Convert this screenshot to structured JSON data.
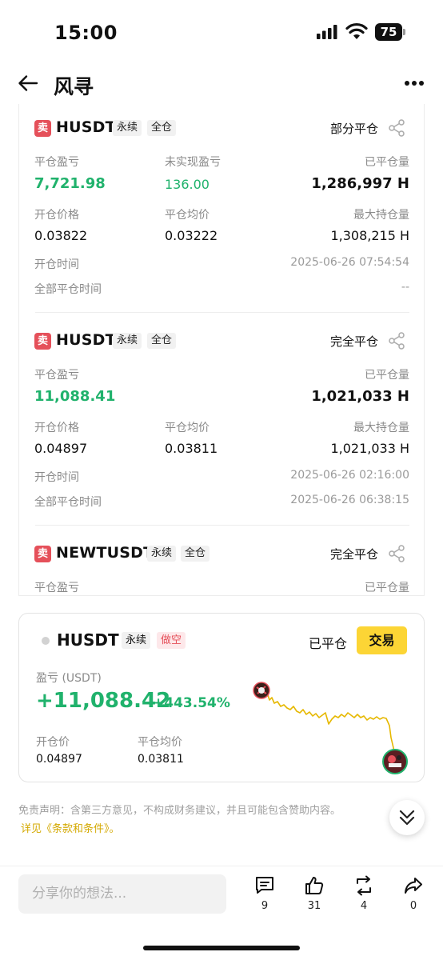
{
  "status_bar": {
    "time": "15:00",
    "battery": "75"
  },
  "nav": {
    "title": "风寻"
  },
  "history": [
    {
      "side_badge": "卖",
      "symbol": "HUSDT",
      "tag_contract": "永续",
      "tag_margin": "全仓",
      "close_status": "部分平仓",
      "pnl_label": "平仓盈亏",
      "pnl_value": "7,721.98",
      "unrealized_label": "未实现盈亏",
      "unrealized_value": "136.00",
      "closed_qty_label": "已平仓量",
      "closed_qty_value": "1,286,997 H",
      "open_price_label": "开仓价格",
      "open_price_value": "0.03822",
      "avg_close_label": "平仓均价",
      "avg_close_value": "0.03222",
      "max_pos_label": "最大持仓量",
      "max_pos_value": "1,308,215 H",
      "open_time_label": "开仓时间",
      "open_time_value": "2025-06-26 07:54:54",
      "close_time_label": "全部平仓时间",
      "close_time_value": "--"
    },
    {
      "side_badge": "卖",
      "symbol": "HUSDT",
      "tag_contract": "永续",
      "tag_margin": "全仓",
      "close_status": "完全平仓",
      "pnl_label": "平仓盈亏",
      "pnl_value": "11,088.41",
      "closed_qty_label": "已平仓量",
      "closed_qty_value": "1,021,033 H",
      "open_price_label": "开仓价格",
      "open_price_value": "0.04897",
      "avg_close_label": "平仓均价",
      "avg_close_value": "0.03811",
      "max_pos_label": "最大持仓量",
      "max_pos_value": "1,021,033 H",
      "open_time_label": "开仓时间",
      "open_time_value": "2025-06-26 02:16:00",
      "close_time_label": "全部平仓时间",
      "close_time_value": "2025-06-26 06:38:15"
    },
    {
      "side_badge": "卖",
      "symbol": "NEWTUSDT",
      "tag_contract": "永续",
      "tag_margin": "全仓",
      "close_status": "完全平仓",
      "pnl_label": "平仓盈亏",
      "closed_qty_label": "已平仓量"
    }
  ],
  "position_card": {
    "symbol": "HUSDT",
    "tag_contract": "永续",
    "tag_direction": "做空",
    "status": "已平仓",
    "trade_button": "交易",
    "pnl_label": "盈亏 (USDT)",
    "pnl_value": "+11,088.42",
    "pnl_percent": "+443.54%",
    "open_price_label": "开仓价",
    "open_price_value": "0.04897",
    "avg_close_label": "平仓均价",
    "avg_close_value": "0.03811",
    "line_color": "#e6b800"
  },
  "disclaimer": {
    "text": "免责声明：含第三方意见，不构成财务建议，并且可能包含赞助内容。",
    "link": "详见《条款和条件》。"
  },
  "bottom_bar": {
    "comment_placeholder": "分享你的想法...",
    "comments": "9",
    "likes": "31",
    "reposts": "4",
    "shares": "0"
  },
  "colors": {
    "green": "#20b26c",
    "red": "#e5505a",
    "yellow": "#fcd535"
  }
}
